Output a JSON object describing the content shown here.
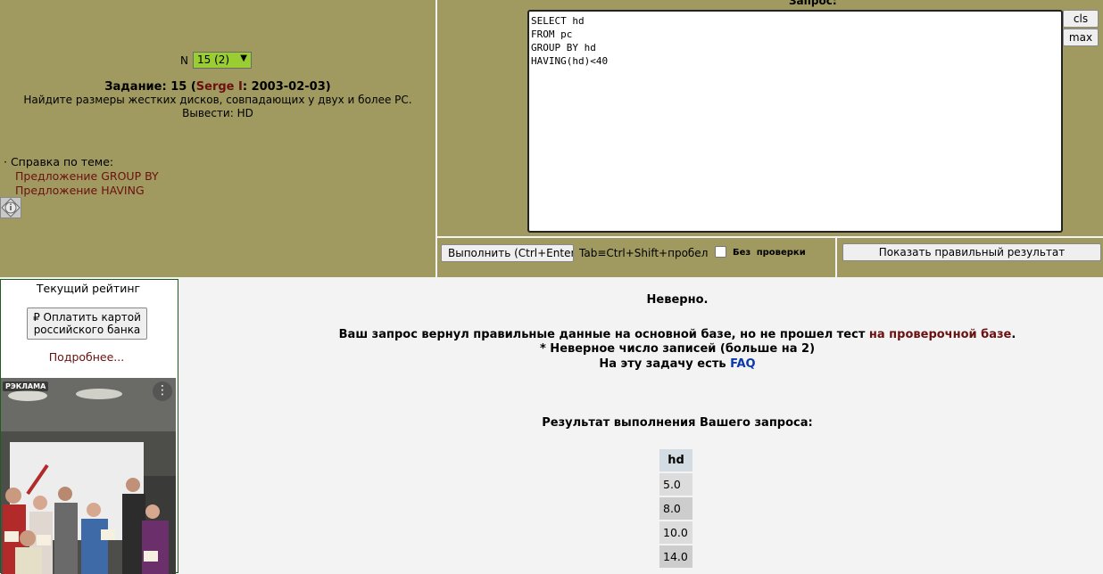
{
  "task": {
    "n_label": "N",
    "n_selected": "15 (2)",
    "title_prefix": "Задание: 15 (",
    "author": "Serge I",
    "title_suffix": ": 2003-02-03)",
    "description": "Найдите размеры жестких дисков, совпадающих у двух и более PC.",
    "output": "Вывести: HD",
    "help_title": "· Справка по теме:",
    "help_links": [
      "Предложение GROUP BY",
      "Предложение HAVING"
    ]
  },
  "query": {
    "label": "Запрос:",
    "text": "SELECT hd\nFROM pc\nGROUP BY hd\nHAVING(hd)<40",
    "cls_label": "cls",
    "max_label": "max",
    "execute_label": "Выполнить (Ctrl+Enter)",
    "tab_hint": "Tab≡Ctrl+Shift+пробел",
    "nocheck_label": "Без проверки",
    "show_result_label": "Показать правильный результат"
  },
  "sidebar": {
    "rating_title": "Текущий рейтинг",
    "pay_button": "₽ Оплатить картой российского банка",
    "more_link": "Подробнее...",
    "ad_label": "РЭКЛАМА",
    "ad_menu": "⋮"
  },
  "result": {
    "verdict": "Неверно.",
    "message_prefix": "Ваш запрос вернул правильные данные на основной базе, но не прошел тест ",
    "message_link": "на проверочной базе",
    "message_suffix": ".",
    "row_count_note": "* Неверное число записей (больше на 2)",
    "faq_prefix": "На эту задачу есть ",
    "faq_link": "FAQ",
    "heading": "Результат выполнения Вашего запроса:",
    "column": "hd",
    "rows": [
      "5.0",
      "8.0",
      "10.0",
      "14.0"
    ]
  }
}
